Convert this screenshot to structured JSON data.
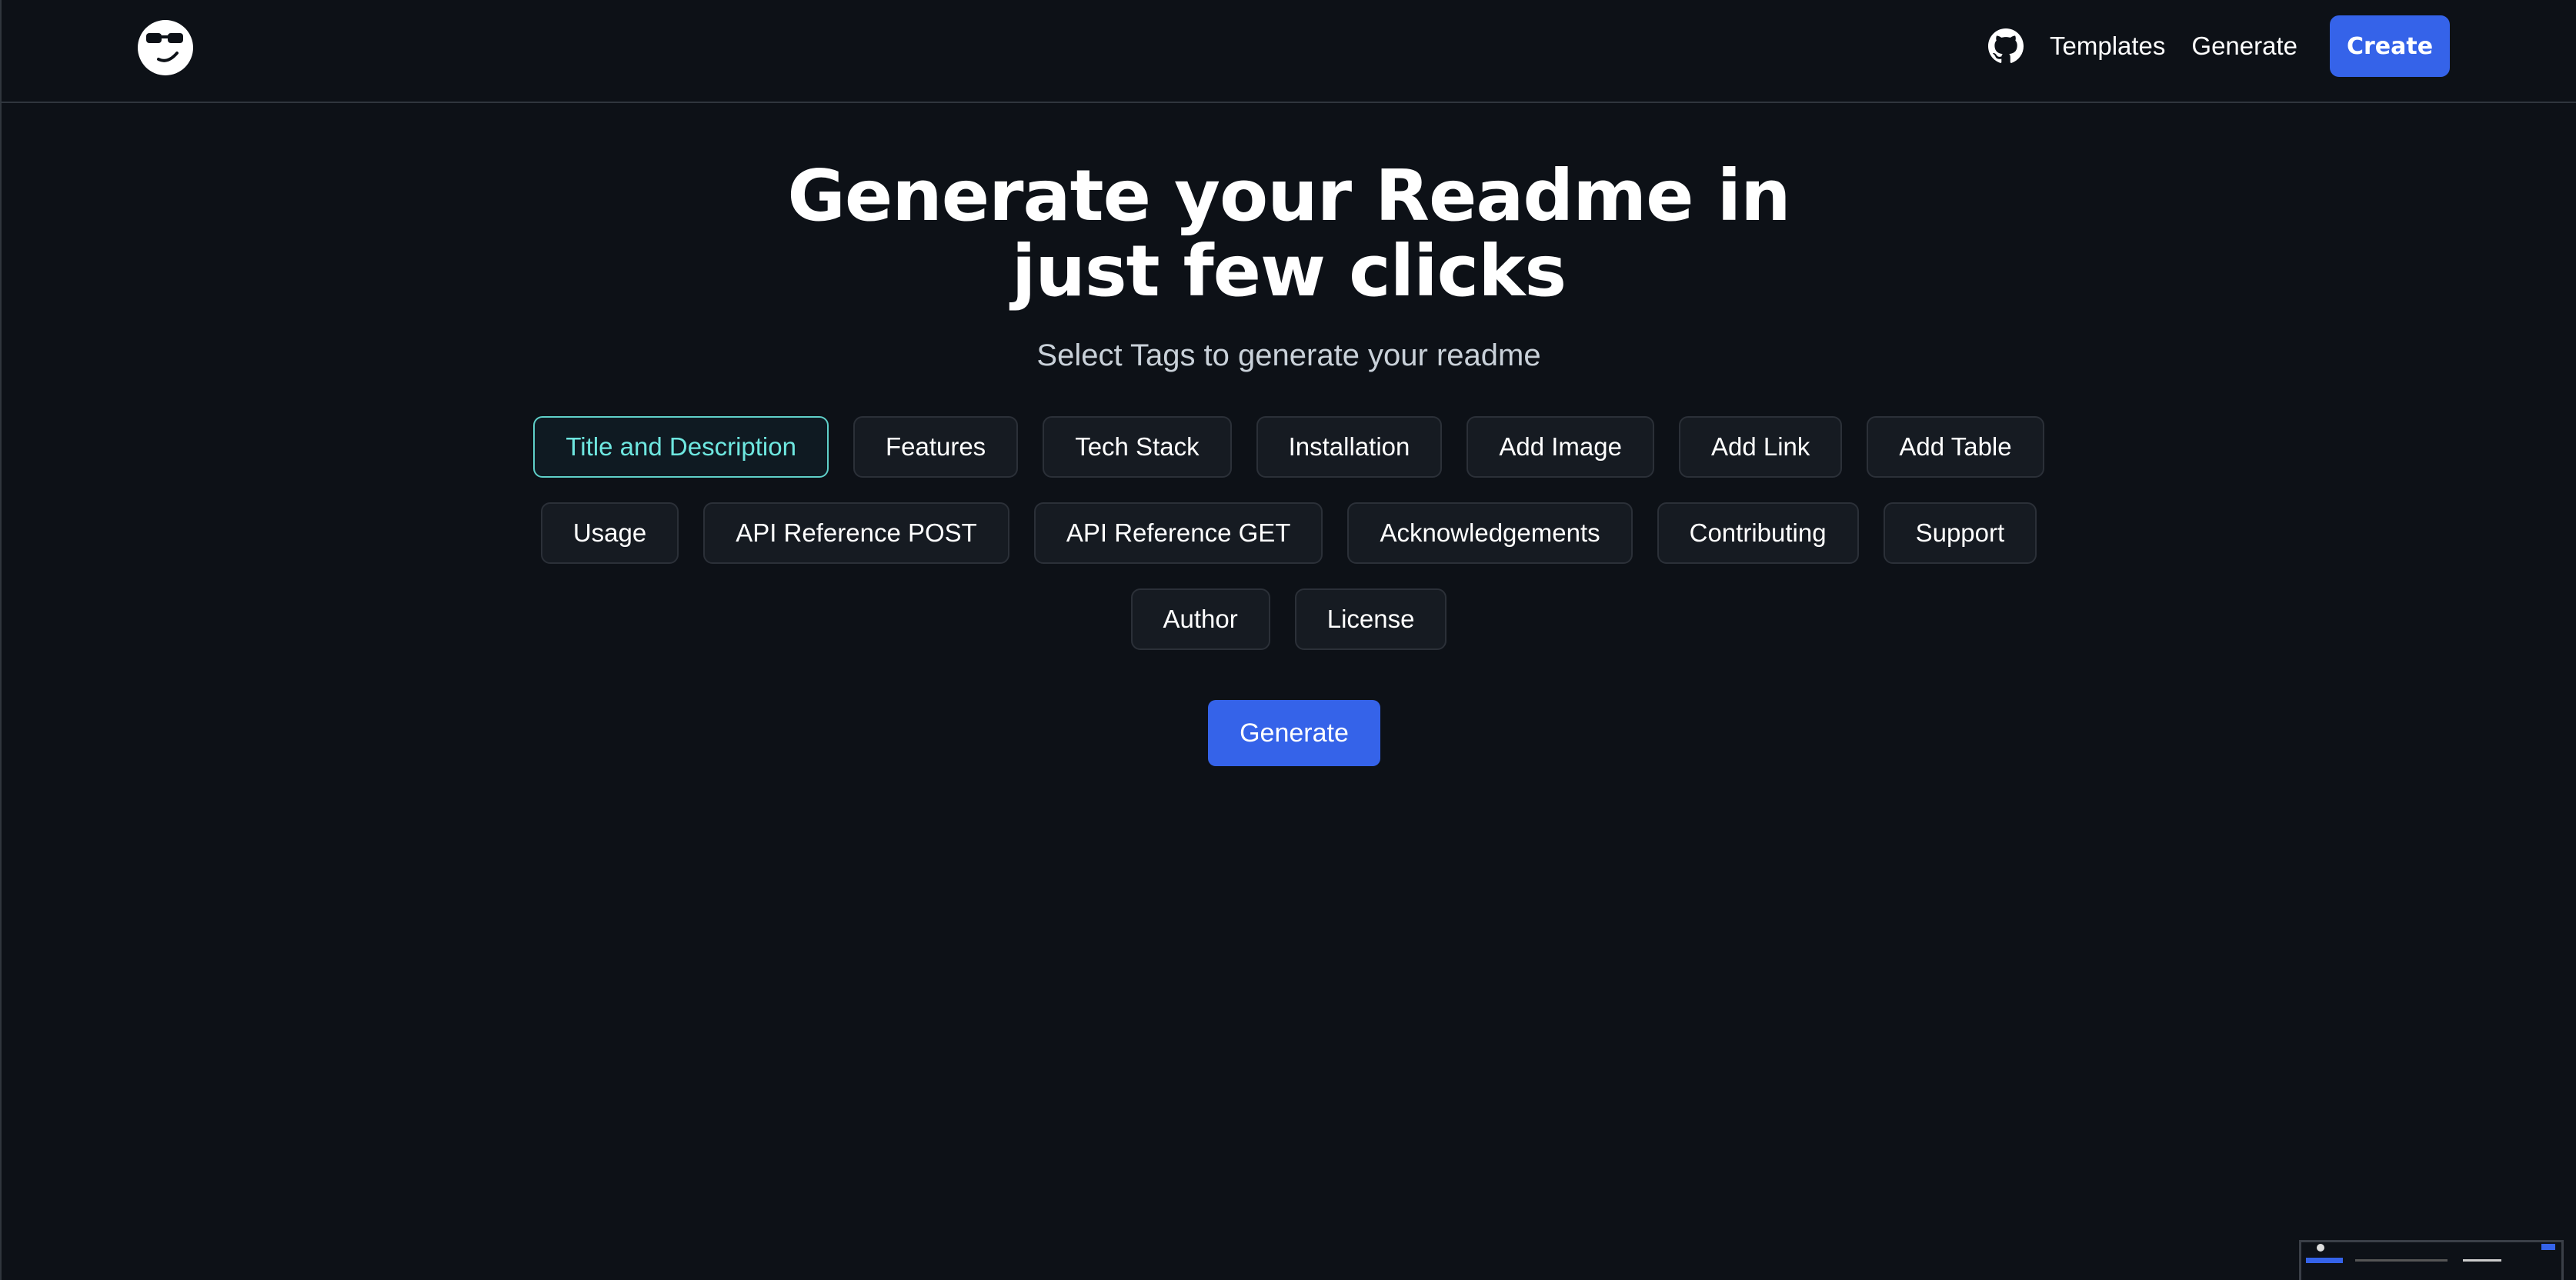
{
  "header": {
    "logo_icon": "sunglasses-smiley-icon",
    "github_icon": "github-icon",
    "nav_links": [
      "Templates",
      "Generate"
    ],
    "create_label": "Create",
    "accent_color": "#3563e9"
  },
  "hero": {
    "title_line1": "Generate your Readme in",
    "title_line2": "just few clicks",
    "subtitle": "Select Tags to generate your readme"
  },
  "tags": {
    "selected_color": "#6ee7e0",
    "rows": [
      [
        "Title and Description",
        "Features",
        "Tech Stack",
        "Installation",
        "Add Image",
        "Add Link",
        "Add Table"
      ],
      [
        "Usage",
        "API Reference POST",
        "API Reference GET",
        "Acknowledgements",
        "Contributing",
        "Support"
      ],
      [
        "Author",
        "License"
      ]
    ],
    "selected": "Title and Description"
  },
  "generate_label": "Generate"
}
